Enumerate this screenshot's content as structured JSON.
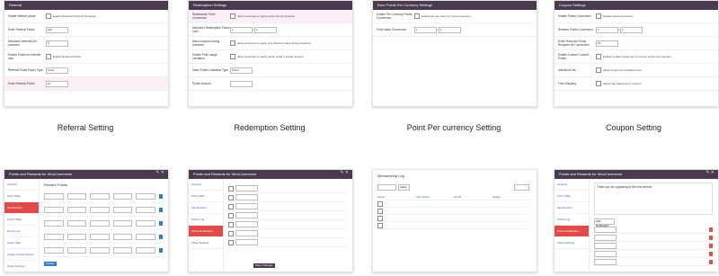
{
  "captions": {
    "c1": "Referral Setting",
    "c2": "Redemption Setting",
    "c3": "Point Per currency Setting",
    "c4": "Coupon Setting"
  },
  "panel1": {
    "title": "Referral",
    "rows": [
      {
        "label": "Enable referral points",
        "type": "check",
        "value": "Enable Referral Points for Purchase"
      },
      {
        "label": "Enter Referral Points",
        "type": "input",
        "value": "100"
      },
      {
        "label": "Maximum referrals per customer",
        "type": "input",
        "value": "5"
      },
      {
        "label": "Enable Points for referred user",
        "type": "check",
        "value": "Enable Referred Points"
      },
      {
        "label": "Referral Points Expiry Type",
        "type": "input",
        "value": "Fixed"
      },
      {
        "label": "Enter Referral Points",
        "type": "input",
        "value": "10"
      }
    ]
  },
  "panel2": {
    "title": "Redemption Settings",
    "rows": [
      {
        "label": "Redemption Point Conversion",
        "type": "check",
        "value": "Allow customers to apply points during checkout"
      },
      {
        "label": "Maximum Redemption Points Limit",
        "type": "input2",
        "value": "1",
        "value2": "1"
      },
      {
        "label": "Allow coupons during checkout",
        "type": "check",
        "value": "Allow customers to apply only discount value during checkout"
      },
      {
        "label": "Enable Point usage Limitation",
        "type": "check",
        "value": "Allow customers to apply points under a certain amount"
      },
      {
        "label": "Value Points Limitation Type",
        "type": "input",
        "value": "Fixed"
      },
      {
        "label": "Points Amount",
        "type": "input",
        "value": ""
      }
    ]
  },
  "panel3": {
    "title": "Earn Points Per Currency Settings",
    "rows": [
      {
        "label": "Enable Per Currency Points Conversion",
        "type": "check",
        "value": "Enable the per currency point conversion"
      },
      {
        "label": "Point Value Conversion",
        "type": "input2",
        "value": "1",
        "value2": "1"
      }
    ]
  },
  "panel4": {
    "title": "Coupon Settings",
    "rows": [
      {
        "label": "Enable Points Conversion",
        "type": "check",
        "value": "Enable points conversion"
      },
      {
        "label": "Redeem Points Conversion",
        "type": "input2",
        "value": "1",
        "value2": "1"
      },
      {
        "label": "Enter Minimum Points Required for Conversion",
        "type": "input",
        "value": "50"
      },
      {
        "label": "Enable Custom Convert Points",
        "type": "check",
        "value": "Enable to allow customers to convert points into coupons"
      },
      {
        "label": "Individual Use",
        "type": "check",
        "value": "Allow Coupon for Individual Use"
      },
      {
        "label": "Free Shipping",
        "type": "check",
        "value": "Allow Free Shipping for Coupon"
      }
    ]
  },
  "panel5": {
    "title": "Points and Rewards for WooCommerce",
    "section": "Reward Points",
    "sidebar": [
      "General",
      "Point Table",
      "Membership",
      "Points Table",
      "Points Log",
      "Order Total",
      "Assign Product Points",
      "Other Settings"
    ],
    "btn": "Update"
  },
  "panel6": {
    "title": "Points and Rewards for WooCommerce",
    "sidebar": [
      "General",
      "Point Table",
      "Membership",
      "Points Log",
      "Points Notification",
      "Other Settings"
    ],
    "btn": "Save Changes"
  },
  "panel7": {
    "title": "Membership Log",
    "headers": [
      "Name",
      "User Name",
      "Email",
      "Status"
    ],
    "btn": "Apply"
  },
  "panel8": {
    "title": "Points and Rewards for WooCommerce",
    "notice": "Thank you for upgrading to the new version",
    "btn": "Add Notification"
  },
  "colors": {
    "header_bg": "#4a3a50",
    "accent_red": "#e04a4a",
    "link_blue": "#3a5aa8",
    "button_blue": "#2f7fc1",
    "highlight_pink": "#fbeef5"
  }
}
